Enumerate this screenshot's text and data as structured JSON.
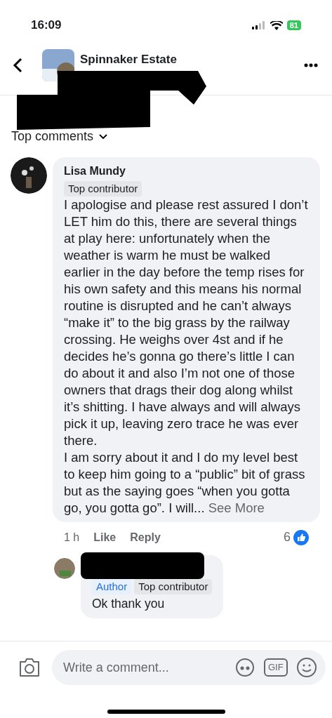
{
  "status_bar": {
    "time": "16:09",
    "battery": "81"
  },
  "header": {
    "group_name": "Spinnaker Estate"
  },
  "sort": {
    "label": "Top comments"
  },
  "comment": {
    "author": "Lisa Mundy",
    "badges": [
      {
        "label": "Top contributor",
        "kind": "contributor"
      }
    ],
    "paragraphs": [
      "I apologise and please rest assured I don’t LET him do this,  there are several things at play here: unfortunately when the weather is warm he must be walked earlier in the day before the temp rises for his own safety and this means his normal routine is disrupted and he can’t always  “make it” to the big grass by the railway crossing. He weighs over 4st and if he decides he’s gonna go there’s little I can do about it and also I’m not one of those owners that drags their dog along whilst it’s shitting. I have always and will always pick it up, leaving zero trace he was ever there.",
      "I am sorry about it and I do my level best to keep him going to a “public” bit of grass but as the saying goes “when you gotta go, you gotta go”. I will..."
    ],
    "see_more": "See More",
    "time": "1 h",
    "like": "Like",
    "reply": "Reply",
    "reaction_count": "6"
  },
  "reply": {
    "badges": [
      {
        "label": "Author",
        "kind": "author"
      },
      {
        "label": "Top contributor",
        "kind": "contributor"
      }
    ],
    "text": "Ok thank you"
  },
  "composer": {
    "placeholder": "Write a comment...",
    "gif": "GIF"
  }
}
